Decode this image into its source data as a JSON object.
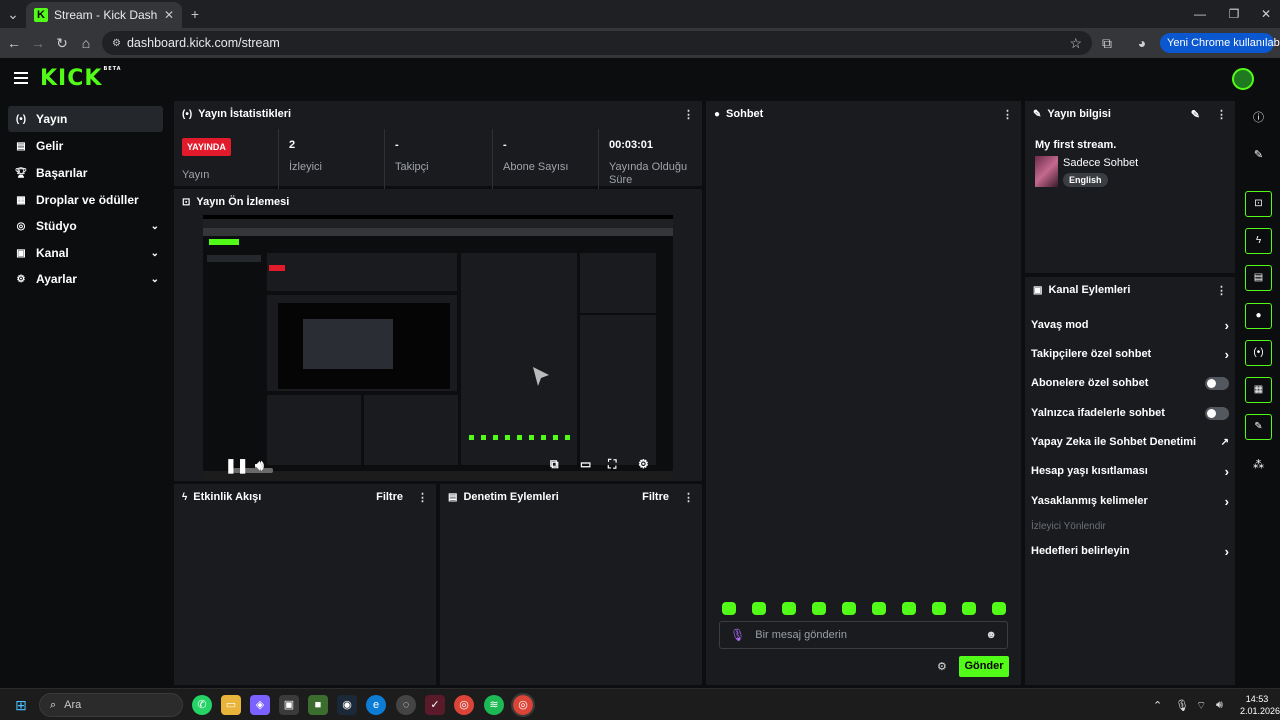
{
  "browser": {
    "tab_title": "Stream - Kick Dashboard",
    "url": "dashboard.kick.com/stream",
    "update_button": "Yeni Chrome kullanılabilir"
  },
  "brand": {
    "logo": "KICK",
    "badge": "BETA",
    "accent": "#53fc18"
  },
  "sidebar": {
    "items": [
      {
        "label": "Yayın",
        "icon": "broadcast-icon",
        "active": true
      },
      {
        "label": "Gelir",
        "icon": "revenue-icon"
      },
      {
        "label": "Başarılar",
        "icon": "trophy-icon"
      },
      {
        "label": "Droplar ve ödüller",
        "icon": "gift-icon"
      },
      {
        "label": "Stüdyo",
        "icon": "studio-icon",
        "expandable": true
      },
      {
        "label": "Kanal",
        "icon": "channel-icon",
        "expandable": true
      },
      {
        "label": "Ayarlar",
        "icon": "gear-icon",
        "expandable": true
      }
    ]
  },
  "stats": {
    "title": "Yayın İstatistikleri",
    "live_badge": "YAYINDA",
    "cells": [
      {
        "value": "2",
        "label": "İzleyici"
      },
      {
        "value": "-",
        "label": "Takipçi"
      },
      {
        "value": "-",
        "label": "Abone Sayısı"
      },
      {
        "value": "00:03:01",
        "label": "Yayında Olduğu Süre"
      }
    ],
    "status_label": "Yayın"
  },
  "preview": {
    "title": "Yayın Ön İzlemesi"
  },
  "activity": {
    "title": "Etkinlik Akışı",
    "filter": "Filtre"
  },
  "moderation": {
    "title": "Denetim Eylemleri",
    "filter": "Filtre"
  },
  "chat": {
    "title": "Sohbet",
    "placeholder": "Bir mesaj gönderin",
    "send": "Gönder"
  },
  "stream_info": {
    "title": "Yayın bilgisi",
    "stream_title": "My first stream.",
    "category": "Sadece Sohbet",
    "language": "English"
  },
  "channel_actions": {
    "title": "Kanal Eylemleri",
    "items": [
      {
        "label": "Yavaş mod",
        "control": "chevron"
      },
      {
        "label": "Takipçilere özel sohbet",
        "control": "chevron"
      },
      {
        "label": "Abonelere özel sohbet",
        "control": "toggle",
        "on": false
      },
      {
        "label": "Yalnızca ifadelerle sohbet",
        "control": "toggle",
        "on": false
      },
      {
        "label": "Yapay Zeka ile Sohbet Denetimi",
        "control": "external"
      },
      {
        "label": "Hesap yaşı kısıtlaması",
        "control": "chevron"
      },
      {
        "label": "Yasaklanmış kelimeler",
        "control": "chevron"
      },
      {
        "label": "İzleyici Yönlendir",
        "control": "none",
        "disabled": true
      },
      {
        "label": "Hedefleri belirleyin",
        "control": "chevron"
      }
    ]
  },
  "taskbar": {
    "search_placeholder": "Ara",
    "time": "14:53",
    "date": "2.01.2026"
  }
}
